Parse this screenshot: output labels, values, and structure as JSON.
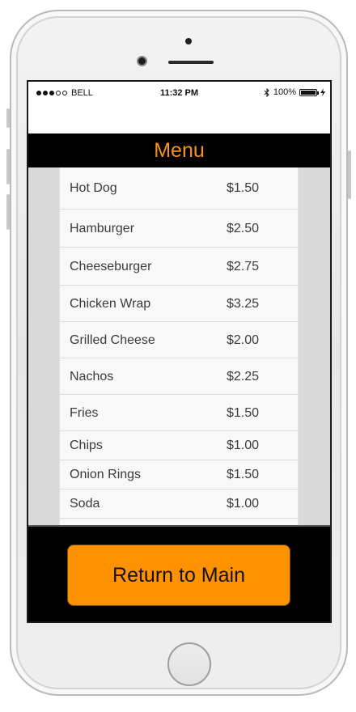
{
  "status_bar": {
    "carrier": "BELL",
    "time": "11:32 PM",
    "battery": "100%",
    "signal_filled": 3,
    "signal_total": 5
  },
  "header": {
    "title": "Menu"
  },
  "menu": {
    "items": [
      {
        "name": "Hot Dog",
        "price": "$1.50"
      },
      {
        "name": "Hamburger",
        "price": "$2.50"
      },
      {
        "name": "Cheeseburger",
        "price": "$2.75"
      },
      {
        "name": "Chicken Wrap",
        "price": "$3.25"
      },
      {
        "name": "Grilled Cheese",
        "price": "$2.00"
      },
      {
        "name": "Nachos",
        "price": "$2.25"
      },
      {
        "name": "Fries",
        "price": "$1.50"
      },
      {
        "name": "Chips",
        "price": "$1.00"
      },
      {
        "name": "Onion Rings",
        "price": "$1.50"
      },
      {
        "name": "Soda",
        "price": "$1.00"
      }
    ]
  },
  "footer": {
    "return_label": "Return to Main"
  },
  "colors": {
    "accent": "#f7931e",
    "button": "#ff9200",
    "bar": "#000000"
  }
}
